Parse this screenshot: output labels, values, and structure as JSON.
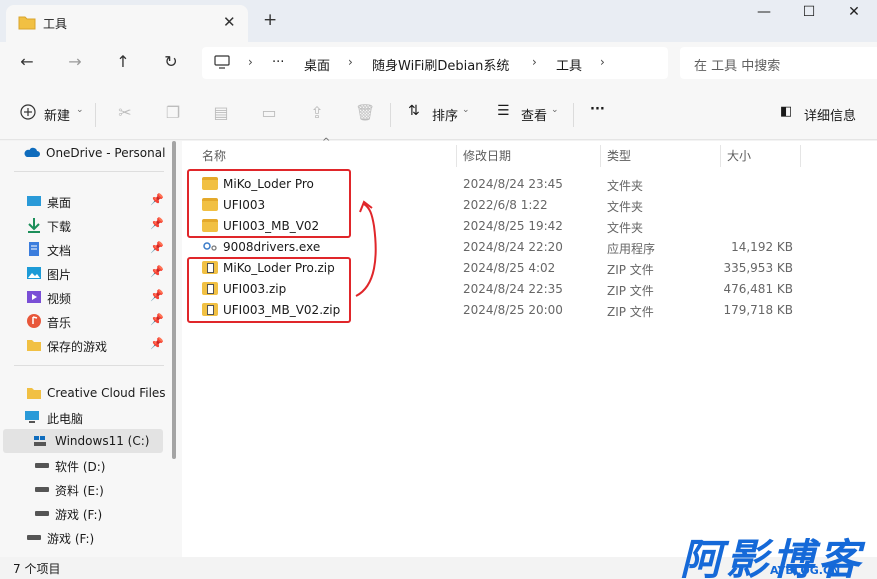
{
  "window": {
    "tab_title": "工具",
    "new_tab": "+",
    "close_tab": "✕",
    "minimize": "—",
    "maximize": "☐",
    "close": "✕"
  },
  "nav": {
    "back": "←",
    "forward": "→",
    "up": "↑",
    "refresh": "↻"
  },
  "breadcrumb": {
    "more": "···",
    "items": [
      "桌面",
      "随身WiFi刷Debian系统",
      "工具"
    ]
  },
  "search": {
    "placeholder": "在 工具 中搜索"
  },
  "toolbar": {
    "new_label": "新建",
    "sort_label": "排序",
    "view_label": "查看",
    "more": "···",
    "details_label": "详细信息"
  },
  "sidebar": {
    "onedrive": "OneDrive - Personal",
    "quick": [
      {
        "label": "桌面"
      },
      {
        "label": "下载"
      },
      {
        "label": "文档"
      },
      {
        "label": "图片"
      },
      {
        "label": "视频"
      },
      {
        "label": "音乐"
      },
      {
        "label": "保存的游戏"
      }
    ],
    "creative_cloud": "Creative Cloud Files",
    "this_pc": "此电脑",
    "drives": [
      {
        "label": "Windows11 (C:)"
      },
      {
        "label": "软件 (D:)"
      },
      {
        "label": "资料 (E:)"
      },
      {
        "label": "游戏 (F:)"
      },
      {
        "label": "游戏 (F:)"
      }
    ]
  },
  "columns": {
    "name": "名称",
    "modified": "修改日期",
    "type": "类型",
    "size": "大小"
  },
  "files": [
    {
      "name": "MiKo_Loder Pro",
      "modified": "2024/8/24 23:45",
      "type": "文件夹",
      "size": "",
      "icon": "folder-icon"
    },
    {
      "name": "UFI003",
      "modified": "2022/6/8 1:22",
      "type": "文件夹",
      "size": "",
      "icon": "folder-icon"
    },
    {
      "name": "UFI003_MB_V02",
      "modified": "2024/8/25 19:42",
      "type": "文件夹",
      "size": "",
      "icon": "folder-icon"
    },
    {
      "name": "9008drivers.exe",
      "modified": "2024/8/24 22:20",
      "type": "应用程序",
      "size": "14,192 KB",
      "icon": "exe-icon"
    },
    {
      "name": "MiKo_Loder Pro.zip",
      "modified": "2024/8/25 4:02",
      "type": "ZIP 文件",
      "size": "335,953 KB",
      "icon": "zip-icon"
    },
    {
      "name": "UFI003.zip",
      "modified": "2024/8/24 22:35",
      "type": "ZIP 文件",
      "size": "476,481 KB",
      "icon": "zip-icon"
    },
    {
      "name": "UFI003_MB_V02.zip",
      "modified": "2024/8/25 20:00",
      "type": "ZIP 文件",
      "size": "179,718 KB",
      "icon": "zip-icon"
    }
  ],
  "status": {
    "count": "7 个项目"
  },
  "watermark": {
    "text": "阿影博客",
    "sub": "AYBLOG.CN"
  },
  "colors": {
    "highlight_box": "#e0262a",
    "folder": "#f1c043",
    "accent": "#0067c0"
  }
}
